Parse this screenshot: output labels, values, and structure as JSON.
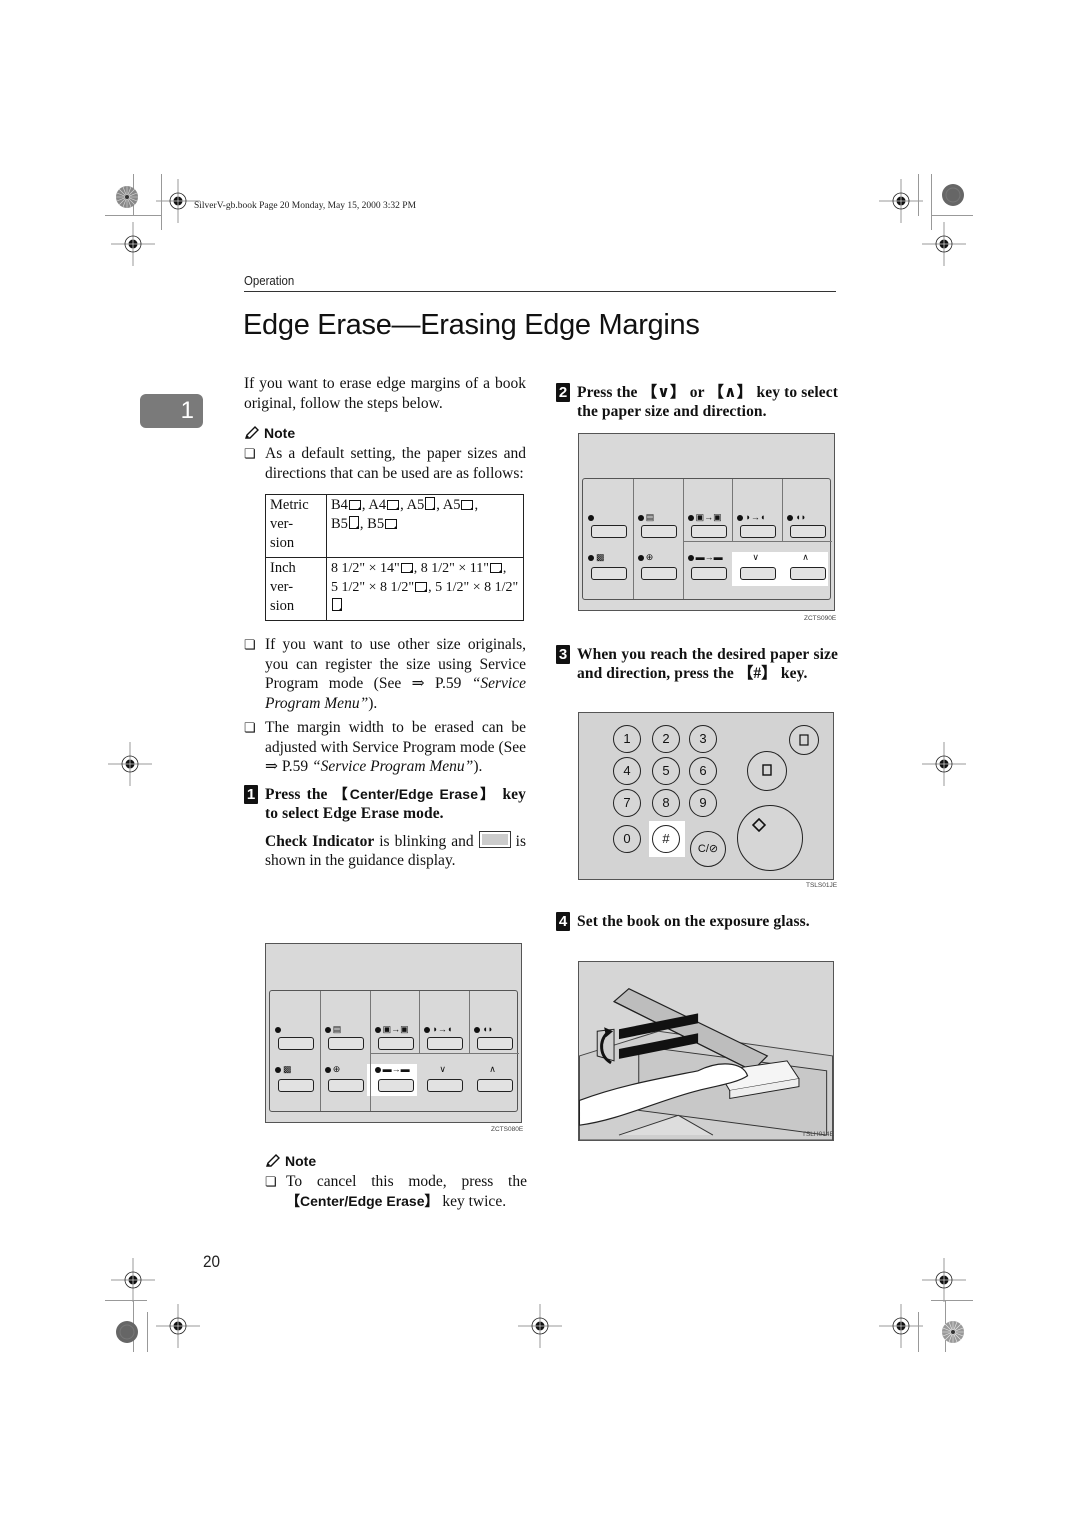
{
  "print_meta": "SilverV-gb.book  Page 20  Monday, May 15, 2000  3:32 PM",
  "header": {
    "section": "Operation",
    "title": "Edge Erase—Erasing Edge Margins"
  },
  "chapter_tab": "1",
  "intro": "If you want to erase edge margins of a book original, follow the steps below.",
  "note1": {
    "heading": "Note",
    "items": [
      {
        "text": "As a default setting, the paper sizes and directions that can be used are as follows:"
      },
      {
        "text_before": "If you want to use other size originals, you can register the size using Service Program mode (See ⇒ P.59 ",
        "ref": "“Service Program Menu”",
        "text_after": ")."
      },
      {
        "text_before": "The margin width to be erased can be adjusted with Service Program mode (See ⇒ P.59 ",
        "ref": "“Service Program Menu”",
        "text_after": ")."
      }
    ]
  },
  "size_table": {
    "rows": [
      {
        "label": "Metric version",
        "label_lines": [
          "Metric",
          "ver-",
          "sion"
        ],
        "sizes": [
          {
            "name": "B4",
            "orient": "landscape"
          },
          {
            "name": "A4",
            "orient": "landscape"
          },
          {
            "name": "A5",
            "orient": "portrait"
          },
          {
            "name": "A5",
            "orient": "landscape"
          },
          {
            "name": "B5",
            "orient": "portrait"
          },
          {
            "name": "B5",
            "orient": "landscape"
          }
        ]
      },
      {
        "label": "Inch version",
        "label_lines": [
          "Inch",
          "ver-",
          "sion"
        ],
        "sizes": [
          {
            "name": "8 1/2\" × 14\"",
            "orient": "landscape"
          },
          {
            "name": "8 1/2\" × 11\"",
            "orient": "landscape"
          },
          {
            "name": "5 1/2\" × 8 1/2\"",
            "orient": "landscape"
          },
          {
            "name": "5 1/2\" × 8 1/2\"",
            "orient": "portrait"
          }
        ]
      }
    ]
  },
  "steps": [
    {
      "number": "1",
      "text_before": "Press the ",
      "key": "【Center/Edge Erase】",
      "text_after": " key to select Edge Erase mode.",
      "detail_bold": "Check Indicator",
      "detail_mid": " is blinking and ",
      "detail_after": " is shown in the guidance display.",
      "figure_label": "ZCTS080E"
    },
    {
      "number": "2",
      "text_before": "Press the ",
      "key_down": "【∨】",
      "text_mid": " or ",
      "key_up": "【∧】",
      "text_after": " key to select the paper size and direction.",
      "figure_label": "ZCTS090E"
    },
    {
      "number": "3",
      "text_before": "When you reach the desired paper size and direction, press the ",
      "key": "【#】",
      "text_after": " key.",
      "figure_label": "TSLS01JE",
      "keypad": [
        "1",
        "2",
        "3",
        "4",
        "5",
        "6",
        "7",
        "8",
        "9",
        "0",
        "#"
      ],
      "clear_stop_label": "C/⊘"
    },
    {
      "number": "4",
      "text": "Set the book on the exposure glass.",
      "figure_label": "TSLH014E"
    }
  ],
  "note2": {
    "heading": "Note",
    "text_before": "To cancel this mode, press the ",
    "key": "【Center/Edge Erase】",
    "text_after": " key twice."
  },
  "panel_icons": {
    "down_arrow": "∨",
    "up_arrow": "∧"
  },
  "page_number": "20"
}
